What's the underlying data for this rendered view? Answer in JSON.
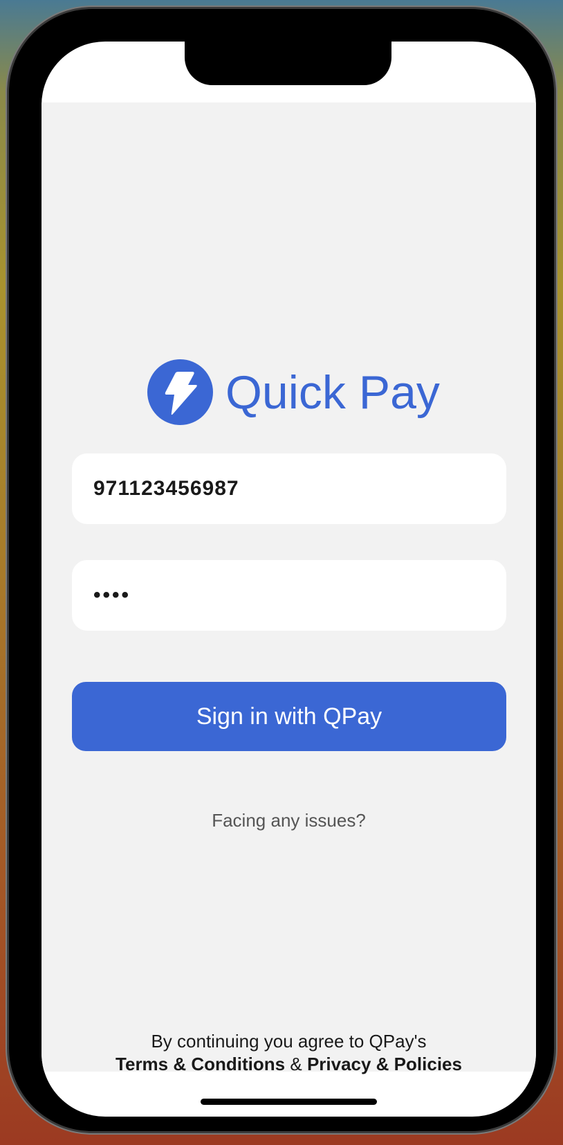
{
  "app": {
    "name": "Quick Pay",
    "brand_color": "#3b67d4",
    "logo_icon": "lightning-bolt-icon"
  },
  "form": {
    "phone_value": "971123456987",
    "password_value": "••••",
    "sign_in_label": "Sign in with QPay",
    "help_link": "Facing any issues?"
  },
  "footer": {
    "agree_text": "By continuing you agree to QPay's",
    "terms_link": "Terms & Conditions",
    "joiner": "&",
    "privacy_link": "Privacy & Policies"
  }
}
